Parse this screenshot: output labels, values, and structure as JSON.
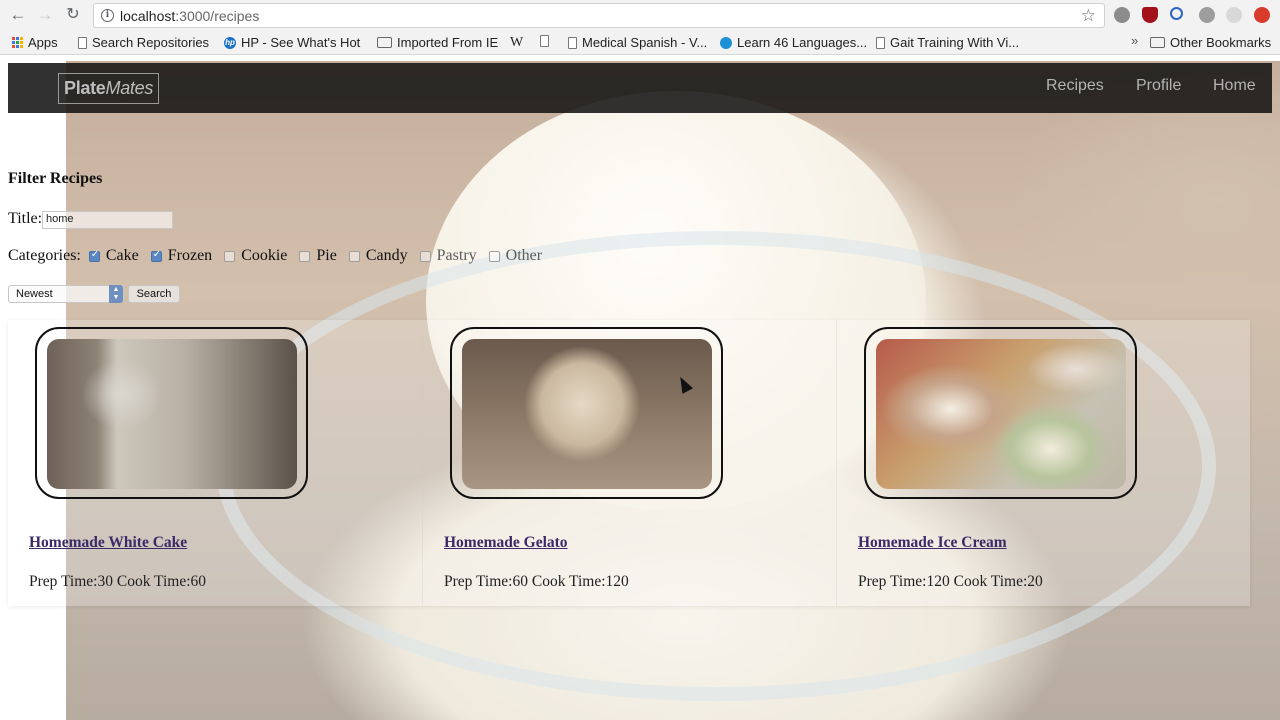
{
  "browser": {
    "url_host": "localhost",
    "url_path": ":3000/recipes",
    "bookmarks": [
      {
        "label": "Apps",
        "icon": "apps-grid-icon"
      },
      {
        "label": "Search Repositories",
        "icon": "page-icon"
      },
      {
        "label": "HP - See What's Hot",
        "icon": "hp-icon"
      },
      {
        "label": "Imported From IE",
        "icon": "folder-icon"
      },
      {
        "label": "W",
        "icon": "wikipedia-icon"
      },
      {
        "label": "",
        "icon": "page-icon"
      },
      {
        "label": "Medical Spanish - V...",
        "icon": "page-icon"
      },
      {
        "label": "Learn 46 Languages...",
        "icon": "site-icon"
      },
      {
        "label": "Gait Training With Vi...",
        "icon": "page-icon"
      },
      {
        "label": "Other Bookmarks",
        "icon": "folder-icon"
      }
    ],
    "more_chevron": "»"
  },
  "navbar": {
    "brand_plain": "Plate",
    "brand_italic": "Mates",
    "links": [
      "Recipes",
      "Profile",
      "Home"
    ]
  },
  "filter": {
    "heading": "Filter Recipes",
    "title_label": "Title:",
    "title_value": "home",
    "categories_label": "Categories:",
    "categories": [
      {
        "label": "Cake",
        "checked": true
      },
      {
        "label": "Frozen",
        "checked": true
      },
      {
        "label": "Cookie",
        "checked": false
      },
      {
        "label": "Pie",
        "checked": false
      },
      {
        "label": "Candy",
        "checked": false
      },
      {
        "label": "Pastry",
        "checked": false
      },
      {
        "label": "Other",
        "checked": false
      }
    ],
    "sort_value": "Newest",
    "search_label": "Search"
  },
  "recipes": [
    {
      "title": "Homemade White Cake",
      "meta": "Prep Time:30 Cook Time:60"
    },
    {
      "title": "Homemade Gelato",
      "meta": "Prep Time:60 Cook Time:120"
    },
    {
      "title": "Homemade Ice Cream",
      "meta": "Prep Time:120 Cook Time:20"
    }
  ],
  "colors": {
    "navbar_bg": "#141414",
    "link_visited": "#3b2a67",
    "checkbox_checked": "#5b87c2"
  }
}
